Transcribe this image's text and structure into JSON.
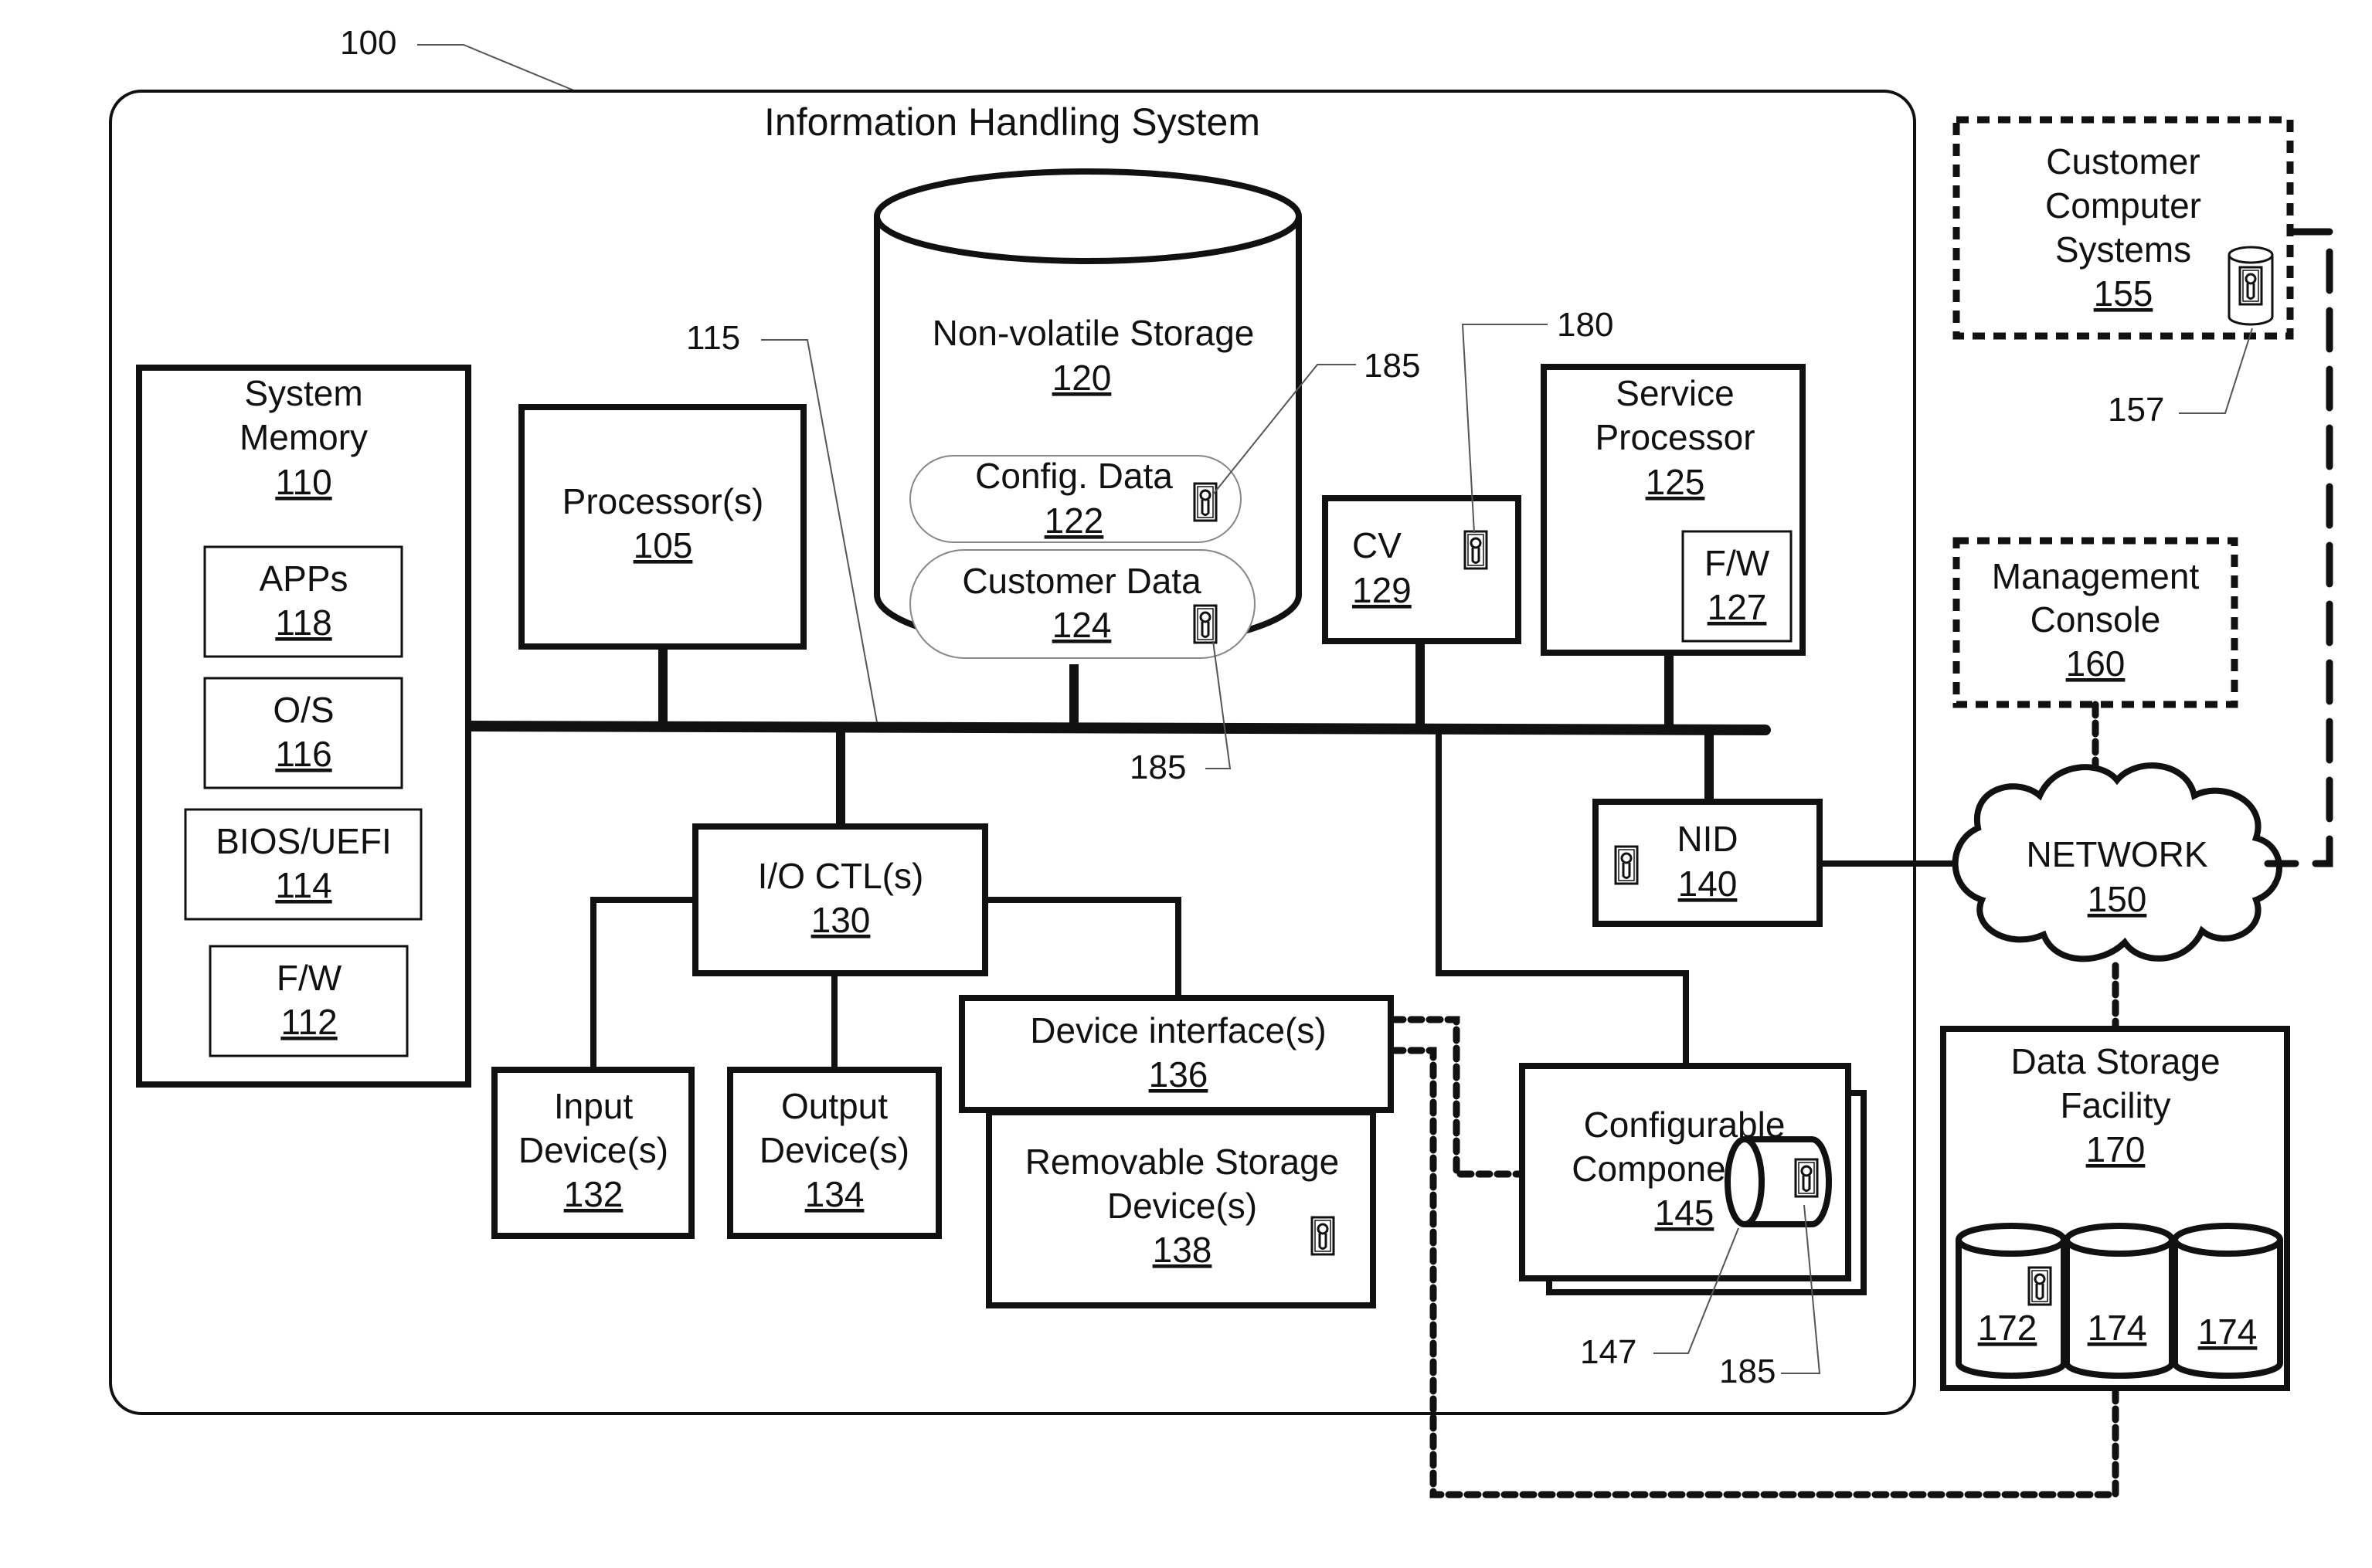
{
  "diagram": {
    "system_ref": "100",
    "system_title": "Information Handling System",
    "bus_ref": "115",
    "components": {
      "system_memory": {
        "label_line1": "System",
        "label_line2": "Memory",
        "ref": "110"
      },
      "apps": {
        "label": "APPs",
        "ref": "118"
      },
      "os": {
        "label": "O/S",
        "ref": "116"
      },
      "bios": {
        "label": "BIOS/UEFI",
        "ref": "114"
      },
      "fw_mem": {
        "label": "F/W",
        "ref": "112"
      },
      "processor": {
        "label": "Processor(s)",
        "ref": "105"
      },
      "nv_storage": {
        "label": "Non-volatile Storage",
        "ref": "120"
      },
      "config_data": {
        "label": "Config. Data",
        "ref": "122"
      },
      "customer_data": {
        "label": "Customer Data",
        "ref": "124"
      },
      "cv": {
        "label": "CV",
        "ref": "129"
      },
      "service_processor": {
        "label_line1": "Service",
        "label_line2": "Processor",
        "ref": "125"
      },
      "fw_sp": {
        "label": "F/W",
        "ref": "127"
      },
      "io_ctl": {
        "label": "I/O CTL(s)",
        "ref": "130"
      },
      "input_dev": {
        "label_line1": "Input",
        "label_line2": "Device(s)",
        "ref": "132"
      },
      "output_dev": {
        "label_line1": "Output",
        "label_line2": "Device(s)",
        "ref": "134"
      },
      "device_iface": {
        "label": "Device interface(s)",
        "ref": "136"
      },
      "removable": {
        "label_line1": "Removable Storage",
        "label_line2": "Device(s)",
        "ref": "138"
      },
      "nid": {
        "label": "NID",
        "ref": "140"
      },
      "configurable": {
        "label_line1": "Configurable",
        "label_line2": "Component(s)",
        "ref": "145"
      },
      "network": {
        "label": "NETWORK",
        "ref": "150"
      },
      "customer_systems": {
        "label_line1": "Customer",
        "label_line2": "Computer",
        "label_line3": "Systems",
        "ref": "155"
      },
      "mgmt_console": {
        "label_line1": "Management",
        "label_line2": "Console",
        "ref": "160"
      },
      "data_storage": {
        "label_line1": "Data Storage",
        "label_line2": "Facility",
        "ref": "170"
      },
      "disk_172": {
        "ref": "172"
      },
      "disk_174a": {
        "ref": "174"
      },
      "disk_174b": {
        "ref": "174"
      }
    },
    "callouts": {
      "c185_config": "185",
      "c185_customer": "185",
      "c180": "180",
      "c157": "157",
      "c147": "147",
      "c185_component": "185"
    },
    "icons": {
      "key": "key-lock-icon"
    }
  }
}
